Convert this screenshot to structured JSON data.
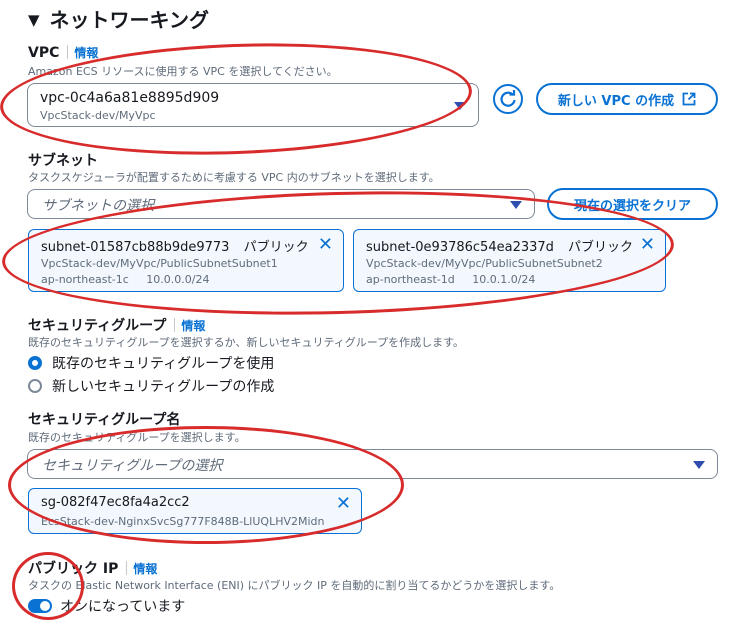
{
  "section": {
    "title": "ネットワーキング"
  },
  "vpc": {
    "label": "VPC",
    "info": "情報",
    "description": "Amazon ECS リソースに使用する VPC を選択してください。",
    "selected_value": "vpc-0c4a6a81e8895d909",
    "selected_sub": "VpcStack-dev/MyVpc",
    "create_button": "新しい VPC の作成",
    "create_icon": "external-link-icon",
    "refresh_icon": "refresh-icon"
  },
  "subnet": {
    "label": "サブネット",
    "description": "タスクスケジューラが配置するために考慮する VPC 内のサブネットを選択します。",
    "placeholder": "サブネットの選択",
    "clear_button": "現在の選択をクリア",
    "tokens": [
      {
        "id": "subnet-01587cb88b9de9773",
        "type": "パブリック",
        "name": "VpcStack-dev/MyVpc/PublicSubnetSubnet1",
        "az": "ap-northeast-1c",
        "cidr": "10.0.0.0/24"
      },
      {
        "id": "subnet-0e93786c54ea2337d",
        "type": "パブリック",
        "name": "VpcStack-dev/MyVpc/PublicSubnetSubnet2",
        "az": "ap-northeast-1d",
        "cidr": "10.0.1.0/24"
      }
    ]
  },
  "security_group": {
    "label": "セキュリティグループ",
    "info": "情報",
    "description": "既存のセキュリティグループを選択するか、新しいセキュリティグループを作成します。",
    "options": [
      {
        "label": "既存のセキュリティグループを使用",
        "selected": true
      },
      {
        "label": "新しいセキュリティグループの作成",
        "selected": false
      }
    ]
  },
  "security_group_name": {
    "label": "セキュリティグループ名",
    "description": "既存のセキュリティグループを選択します。",
    "placeholder": "セキュリティグループの選択",
    "token": {
      "id": "sg-082f47ec8fa4a2cc2",
      "name": "EcsStack-dev-NginxSvcSg777F848B-LlUQLHV2Midn"
    }
  },
  "public_ip": {
    "label": "パブリック IP",
    "info": "情報",
    "description": "タスクの Elastic Network Interface (ENI) にパブリック IP を自動的に割り当てるかどうかを選択します。",
    "toggle_label": "オンになっています",
    "enabled": true
  },
  "colors": {
    "accent": "#0972d3",
    "annotation": "#d82b2b"
  }
}
